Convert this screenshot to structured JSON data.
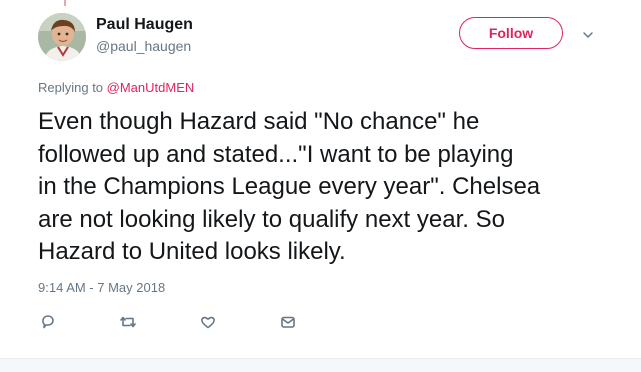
{
  "user": {
    "display_name": "Paul Haugen",
    "handle": "@paul_haugen"
  },
  "follow": {
    "label": "Follow"
  },
  "reply_context": {
    "prefix": "Replying to ",
    "mention": "@ManUtdMEN"
  },
  "tweet": {
    "text": "Even though Hazard said \"No chance\" he\nfollowed up and stated...\"I want to be playing\nin the Champions League every year\". Chelsea\nare not looking likely to qualify next year. So\nHazard to United looks likely.",
    "timestamp": "9:14 AM - 7 May 2018"
  },
  "actions": [
    {
      "icon": "reply-icon"
    },
    {
      "icon": "retweet-icon"
    },
    {
      "icon": "heart-icon"
    },
    {
      "icon": "envelope-icon"
    }
  ],
  "colors": {
    "accent": "#e0245e",
    "text": "#14171a",
    "secondary": "#657786"
  }
}
